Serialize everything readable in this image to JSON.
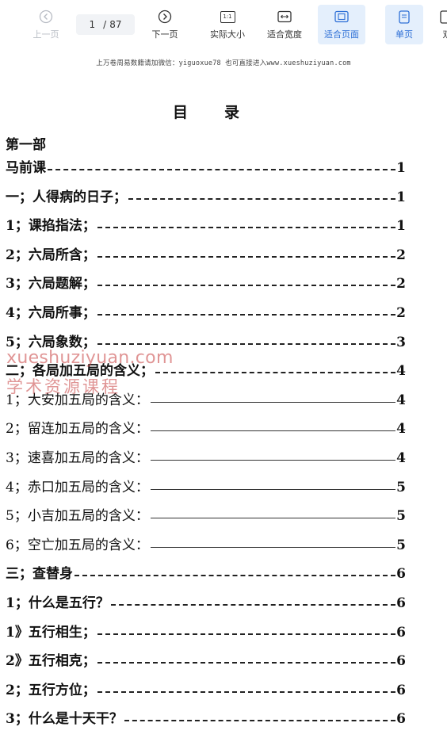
{
  "toolbar": {
    "prev_label": "上一页",
    "current_page": "1",
    "page_separator": "/",
    "total_pages": "87",
    "next_label": "下一页",
    "actual_size_label": "实际大小",
    "actual_size_icon_text": "1:1",
    "fit_width_label": "适合宽度",
    "fit_page_label": "适合页面",
    "single_page_label": "单页",
    "cut_label": "双"
  },
  "document": {
    "header_note": "上万卷周易数籍请加微信：yiguoxue78   也可直接进入www.xueshuziyuan.com",
    "title": "目录",
    "part_label": "第一部",
    "entries": [
      {
        "text": "马前课",
        "page": "1"
      },
      {
        "text": "一；人得病的日子；",
        "page": "1"
      },
      {
        "text": "1；课掐指法；",
        "page": "1"
      },
      {
        "text": "2；六局所含；",
        "page": "2"
      },
      {
        "text": "3；六局题解；",
        "page": "2"
      },
      {
        "text": "4；六局所事；",
        "page": "2"
      },
      {
        "text": "5；六局象数；",
        "page": "3"
      },
      {
        "text": "二；各局加五局的含义；",
        "page": "4"
      },
      {
        "text": "1；大安加五局的含义：",
        "page": "4"
      },
      {
        "text": "2；留连加五局的含义：",
        "page": "4"
      },
      {
        "text": "3；速喜加五局的含义：",
        "page": "4"
      },
      {
        "text": "4；赤口加五局的含义：",
        "page": "5"
      },
      {
        "text": "5；小吉加五局的含义：",
        "page": "5"
      },
      {
        "text": "6；空亡加五局的含义：",
        "page": "5"
      },
      {
        "text": "三；查替身",
        "page": "6"
      },
      {
        "text": "1；什么是五行？",
        "page": "6"
      },
      {
        "text": "1》五行相生；",
        "page": "6"
      },
      {
        "text": "2》五行相克；",
        "page": "6"
      },
      {
        "text": "2；五行方位；",
        "page": "6"
      },
      {
        "text": "3；什么是十天干？",
        "page": "6"
      }
    ]
  },
  "watermark": {
    "line1": "xueshuziyuan.com",
    "line2": "学术资源课程"
  }
}
